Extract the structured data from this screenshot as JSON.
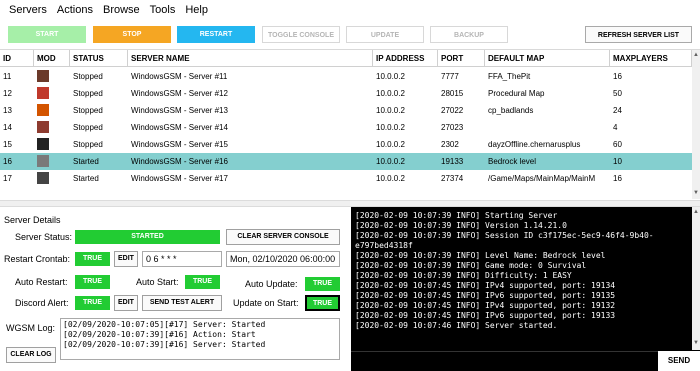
{
  "menu": [
    "Servers",
    "Actions",
    "Browse",
    "Tools",
    "Help"
  ],
  "toolbar": {
    "start": "Start",
    "stop": "Stop",
    "restart": "Restart",
    "toggle": "Toggle Console",
    "update": "Update",
    "backup": "Backup",
    "refresh": "Refresh Server List"
  },
  "table": {
    "headers": [
      "ID",
      "MOD",
      "STATUS",
      "SERVER NAME",
      "IP ADDRESS",
      "PORT",
      "DEFAULT MAP",
      "MAXPLAYERS"
    ],
    "rows": [
      {
        "id": "11",
        "status": "Stopped",
        "name": "WindowsGSM - Server #11",
        "ip": "10.0.0.2",
        "port": "7777",
        "map": "FFA_ThePit",
        "max": "16",
        "mod_color": "#6b3a2a"
      },
      {
        "id": "12",
        "status": "Stopped",
        "name": "WindowsGSM - Server #12",
        "ip": "10.0.0.2",
        "port": "28015",
        "map": "Procedural Map",
        "max": "50",
        "mod_color": "#c0392b"
      },
      {
        "id": "13",
        "status": "Stopped",
        "name": "WindowsGSM - Server #13",
        "ip": "10.0.0.2",
        "port": "27022",
        "map": "cp_badlands",
        "max": "24",
        "mod_color": "#d35400"
      },
      {
        "id": "14",
        "status": "Stopped",
        "name": "WindowsGSM - Server #14",
        "ip": "10.0.0.2",
        "port": "27023",
        "map": "",
        "max": "4",
        "mod_color": "#8e3b2f"
      },
      {
        "id": "15",
        "status": "Stopped",
        "name": "WindowsGSM - Server #15",
        "ip": "10.0.0.2",
        "port": "2302",
        "map": "dayzOffline.chernarusplus",
        "max": "60",
        "mod_color": "#222222"
      },
      {
        "id": "16",
        "status": "Started",
        "name": "WindowsGSM - Server #16",
        "ip": "10.0.0.2",
        "port": "19133",
        "map": "Bedrock level",
        "max": "10",
        "mod_color": "#7a7a7a"
      },
      {
        "id": "17",
        "status": "Started",
        "name": "WindowsGSM - Server #17",
        "ip": "10.0.0.2",
        "port": "27374",
        "map": "/Game/Maps/MainMap/MainM",
        "max": "16",
        "mod_color": "#444444"
      }
    ]
  },
  "details": {
    "title": "Server Details",
    "status_label": "Server Status:",
    "status_value": "Started",
    "clear_console": "Clear Server Console",
    "crontab_label": "Restart Crontab:",
    "crontab_toggle": "True",
    "edit": "Edit",
    "crontab_value": "0 6 * * *",
    "crontab_next": "Mon, 02/10/2020 06:00:00",
    "auto_restart_label": "Auto Restart:",
    "auto_restart": "True",
    "auto_start_label": "Auto Start:",
    "auto_start": "True",
    "auto_update_label": "Auto Update:",
    "auto_update": "True",
    "discord_label": "Discord Alert:",
    "discord": "True",
    "send_test": "Send Test Alert",
    "update_start_label": "Update on Start:",
    "update_start": "True",
    "log_label": "WGSM Log:",
    "clear_log": "Clear Log",
    "log": [
      "[02/09/2020-10:07:05][#17] Server: Started",
      "[02/09/2020-10:07:39][#16] Action: Start",
      "[02/09/2020-10:07:39][#16] Server: Started"
    ]
  },
  "console": {
    "lines": [
      "[2020-02-09 10:07:39 INFO] Starting Server",
      "[2020-02-09 10:07:39 INFO] Version 1.14.21.0",
      "[2020-02-09 10:07:39 INFO] Session ID c3f175ec-5ec9-46f4-9b40-",
      "e797bed4318f",
      "[2020-02-09 10:07:39 INFO] Level Name: Bedrock level",
      "[2020-02-09 10:07:39 INFO] Game mode: 0 Survival",
      "[2020-02-09 10:07:39 INFO] Difficulty: 1 EASY",
      "[2020-02-09 10:07:45 INFO] IPv4 supported, port: 19134",
      "[2020-02-09 10:07:45 INFO] IPv6 supported, port: 19135",
      "[2020-02-09 10:07:45 INFO] IPv4 supported, port: 19132",
      "[2020-02-09 10:07:45 INFO] IPv6 supported, port: 19133",
      "[2020-02-09 10:07:46 INFO] Server started."
    ],
    "send": "Send"
  }
}
